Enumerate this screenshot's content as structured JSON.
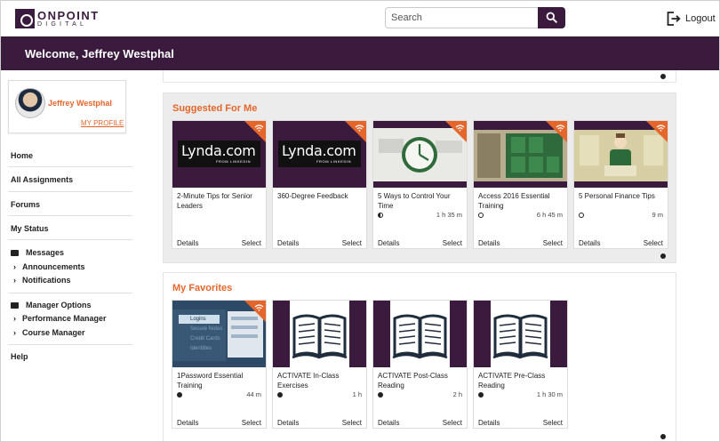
{
  "header": {
    "logo_top": "ONPOINT",
    "logo_bottom": "DIGITAL",
    "search_placeholder": "Search",
    "logout_label": "Logout",
    "icons": {
      "search": "search-icon",
      "logout": "logout-icon"
    }
  },
  "welcome": {
    "text": "Welcome, Jeffrey Westphal"
  },
  "profile": {
    "name": "Jeffrey Westphal",
    "link": "MY PROFILE"
  },
  "nav": {
    "home": "Home",
    "all_assignments": "All Assignments",
    "forums": "Forums",
    "my_status": "My Status",
    "messages": "Messages",
    "announcements": "Announcements",
    "notifications": "Notifications",
    "manager_options": "Manager Options",
    "performance_manager": "Performance Manager",
    "course_manager": "Course Manager",
    "help": "Help"
  },
  "suggested": {
    "title": "Suggested For Me",
    "cards": [
      {
        "title": "2-Minute Tips for Senior Leaders",
        "duration": "",
        "status": "none",
        "thumb": "lynda",
        "details": "Details",
        "select": "Select"
      },
      {
        "title": "360-Degree Feedback",
        "duration": "",
        "status": "none",
        "thumb": "lynda",
        "details": "Details",
        "select": "Select"
      },
      {
        "title": "5 Ways to Control Your Time",
        "duration": "1 h 35 m",
        "status": "half",
        "thumb": "clock",
        "details": "Details",
        "select": "Select"
      },
      {
        "title": "Access 2016 Essential Training",
        "duration": "6 h 45 m",
        "status": "ring",
        "thumb": "access",
        "details": "Details",
        "select": "Select"
      },
      {
        "title": "5 Personal Finance Tips",
        "duration": "9 m",
        "status": "ring",
        "thumb": "finance",
        "details": "Details",
        "select": "Select"
      }
    ]
  },
  "favorites": {
    "title": "My Favorites",
    "cards": [
      {
        "title": "1Password Essential Training",
        "duration": "44 m",
        "status": "dot",
        "thumb": "password",
        "details": "Details",
        "select": "Select",
        "thumb_items": [
          "Logins",
          "Secure Notes",
          "Credit Cards",
          "Identities"
        ]
      },
      {
        "title": "ACTIVATE In-Class Exercises",
        "duration": "1 h",
        "status": "dot",
        "thumb": "book",
        "details": "Details",
        "select": "Select"
      },
      {
        "title": "ACTIVATE Post-Class Reading",
        "duration": "2 h",
        "status": "dot",
        "thumb": "book",
        "details": "Details",
        "select": "Select"
      },
      {
        "title": "ACTIVATE Pre-Class Reading",
        "duration": "1 h 30 m",
        "status": "dot",
        "thumb": "book",
        "details": "Details",
        "select": "Select"
      }
    ]
  },
  "lynda": {
    "big": "Lynda.com",
    "small": "FROM LINKEDIN"
  },
  "colors": {
    "brand": "#3a1b3e",
    "accent": "#e5662a",
    "panel_bg": "#ececec"
  }
}
